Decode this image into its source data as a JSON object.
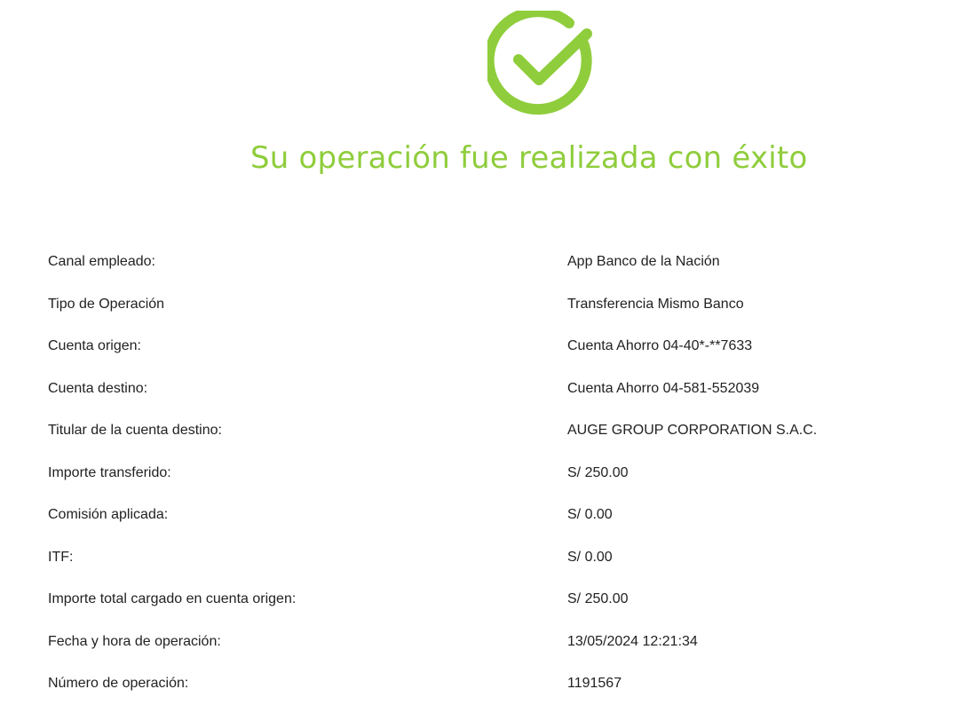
{
  "brand": {
    "success_color": "#8fcd3c",
    "text_color": "#222222"
  },
  "header": {
    "icon": "check-circle-icon",
    "title": "Su operación fue realizada con éxito"
  },
  "details": [
    {
      "label": "Canal empleado:",
      "value": "App Banco de la Nación"
    },
    {
      "label": "Tipo de Operación",
      "value": "Transferencia Mismo Banco"
    },
    {
      "label": "Cuenta origen:",
      "value": "Cuenta Ahorro 04-40*-**7633"
    },
    {
      "label": "Cuenta destino:",
      "value": "Cuenta Ahorro 04-581-552039"
    },
    {
      "label": "Titular de la cuenta destino:",
      "value": "AUGE GROUP CORPORATION S.A.C."
    },
    {
      "label": "Importe transferido:",
      "value": "S/ 250.00"
    },
    {
      "label": "Comisión aplicada:",
      "value": "S/ 0.00"
    },
    {
      "label": "ITF:",
      "value": "S/ 0.00"
    },
    {
      "label": "Importe total cargado en cuenta origen:",
      "value": "S/ 250.00"
    },
    {
      "label": "Fecha y hora de operación:",
      "value": "13/05/2024 12:21:34"
    },
    {
      "label": "Número de operación:",
      "value": "1191567"
    }
  ]
}
